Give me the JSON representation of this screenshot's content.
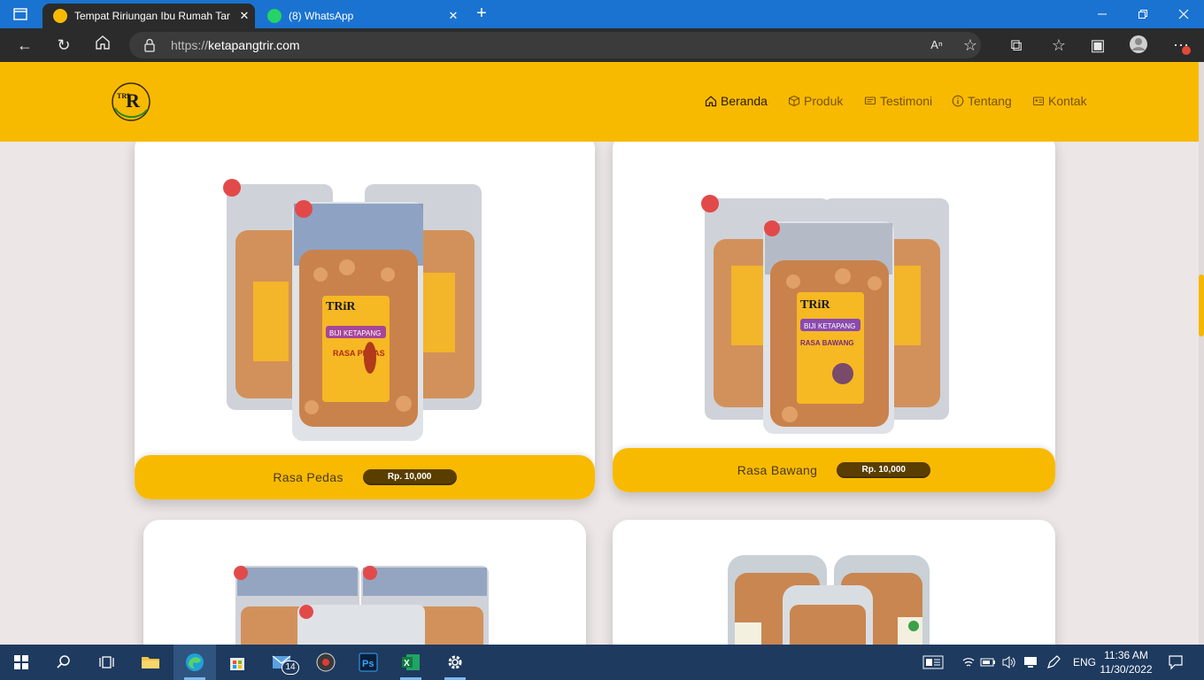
{
  "browser": {
    "tabs": [
      {
        "title": "Tempat Ririungan Ibu Rumah Tar",
        "active": true
      },
      {
        "title": "(8) WhatsApp",
        "active": false
      }
    ],
    "url_prefix": "https://",
    "url_domain": "ketapangtrir.com"
  },
  "site": {
    "logo_text": "TRiR",
    "nav": [
      {
        "label": "Beranda",
        "icon": "home-icon",
        "active": true
      },
      {
        "label": "Produk",
        "icon": "box-icon",
        "active": false
      },
      {
        "label": "Testimoni",
        "icon": "chat-icon",
        "active": false
      },
      {
        "label": "Tentang",
        "icon": "info-icon",
        "active": false
      },
      {
        "label": "Kontak",
        "icon": "contact-card-icon",
        "active": false
      }
    ],
    "products": [
      {
        "name": "Rasa Pedas",
        "price": "Rp. 10,000",
        "package_label": "BIJI KETAPANG",
        "flavor_label": "RASA PEDAS"
      },
      {
        "name": "Rasa Bawang",
        "price": "Rp. 10,000",
        "package_label": "BIJI KETAPANG",
        "flavor_label": "RASA BAWANG"
      }
    ]
  },
  "taskbar": {
    "mail_badge": "14",
    "language": "ENG",
    "time": "11:36 AM",
    "date": "11/30/2022"
  },
  "colors": {
    "brand_yellow": "#f8ba00",
    "price_pill": "#5a3e00",
    "page_bg": "#ece6e6",
    "browser_blue": "#1a73d0"
  }
}
